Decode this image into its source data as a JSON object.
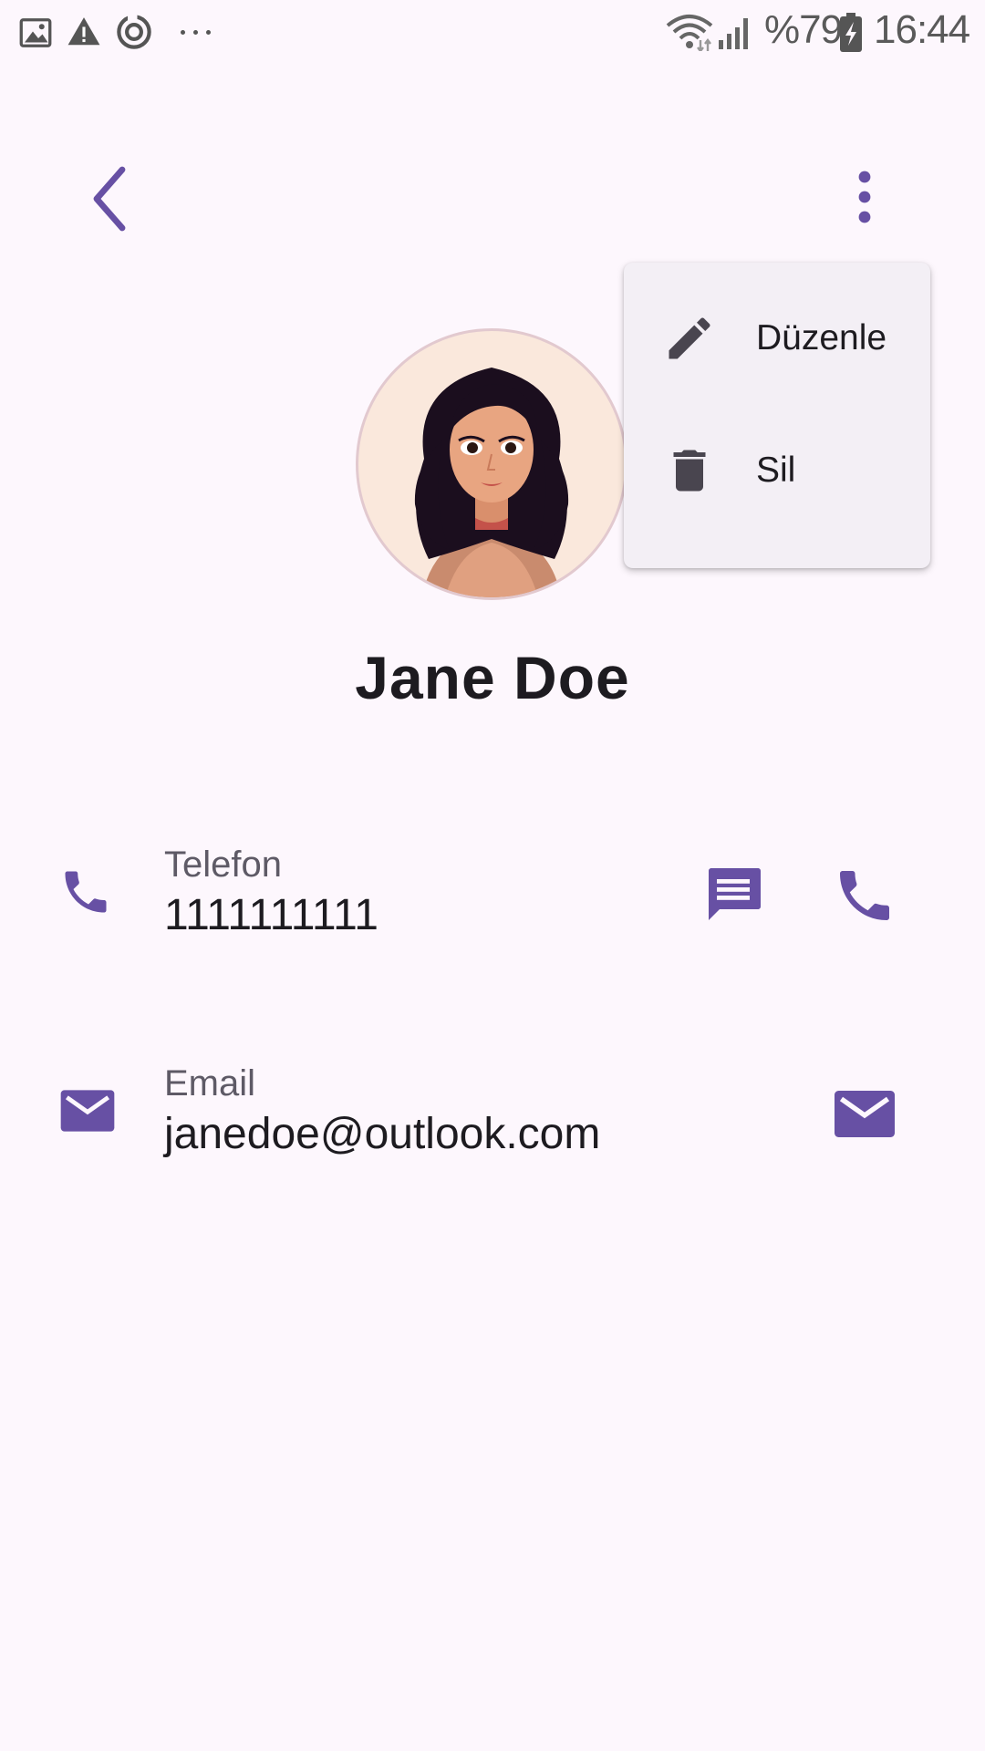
{
  "status_bar": {
    "battery": "%79",
    "time": "16:44",
    "icons": [
      "image-icon",
      "warning-icon",
      "sync-icon",
      "more-dots-icon",
      "wifi-icon",
      "signal-icon",
      "battery-icon"
    ]
  },
  "app_bar": {
    "icons": [
      "back-icon",
      "more-vert-icon"
    ]
  },
  "menu": {
    "items": [
      {
        "label": "Düzenle",
        "icon": "edit-icon"
      },
      {
        "label": "Sil",
        "icon": "delete-icon"
      }
    ]
  },
  "contact": {
    "name": "Jane Doe",
    "phone_label": "Telefon",
    "phone_value": "1111111111",
    "email_label": "Email",
    "email_value": "janedoe@outlook.com"
  },
  "colors": {
    "accent": "#6750A4",
    "background": "#FDF7FD",
    "menu_bg": "#F3EFF5",
    "menu_icon": "#49454F"
  }
}
